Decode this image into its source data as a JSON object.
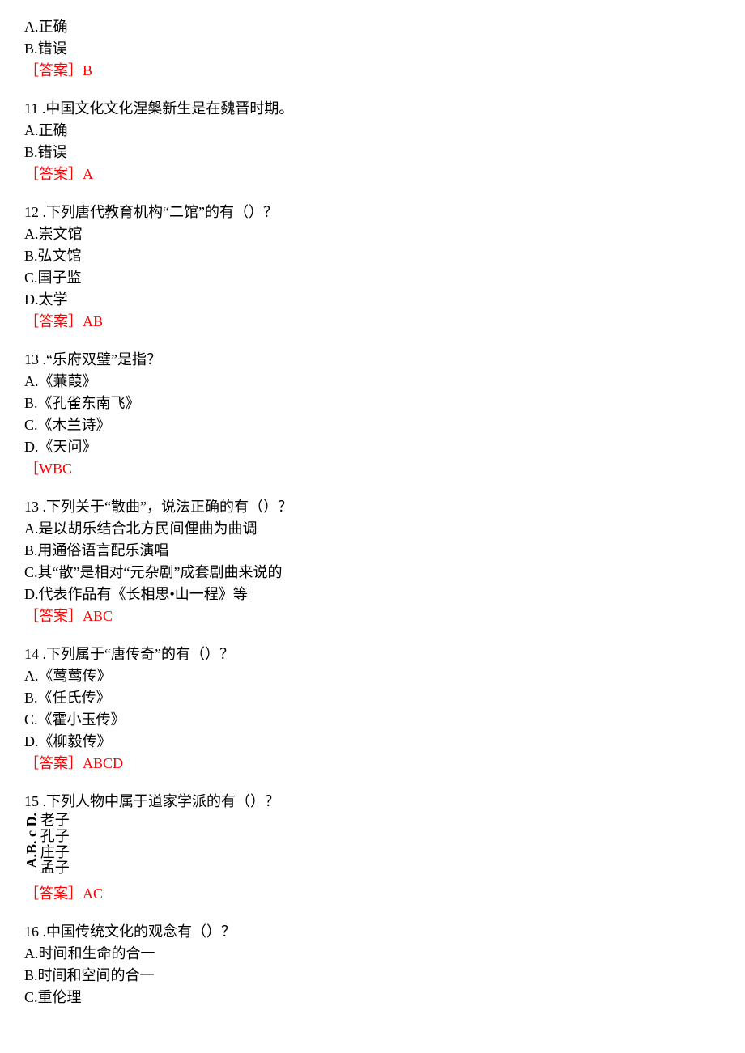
{
  "q10": {
    "optA": "A.正确",
    "optB": "B.错误",
    "answer": "［答案］B"
  },
  "q11": {
    "stem": "11 .中国文化文化涅槃新生是在魏晋时期。",
    "optA": "A.正确",
    "optB": "B.错误",
    "answer": "［答案］A"
  },
  "q12": {
    "stem": "12 .下列唐代教育机构“二馆”的有（）？",
    "optA": "A.崇文馆",
    "optB": "B.弘文馆",
    "optC": "C.国子监",
    "optD": "D.太学",
    "answer": "［答案］AB"
  },
  "q13a": {
    "stem": "13 .“乐府双璧”是指？",
    "optA": "A.《蒹葭》",
    "optB": "B.《孔雀东南飞》",
    "optC": "C.《木兰诗》",
    "optD": "D.《天问》",
    "answer": "［WBC"
  },
  "q13b": {
    "stem": "13 .下列关于“散曲”，说法正确的有（）？",
    "optA": "A.是以胡乐结合北方民间俚曲为曲调",
    "optB": "B.用通俗语言配乐演唱",
    "optC": "C.其“散”是相对“元杂剧”成套剧曲来说的",
    "optD": "D.代表作品有《长相思•山一程》等",
    "answer": "［答案］ABC"
  },
  "q14": {
    "stem": "14 .下列属于“唐传奇”的有（）？",
    "optA": "A.《莺莺传》",
    "optB": "B.《任氏传》",
    "optC": "C.《霍小玉传》",
    "optD": "D.《柳毅传》",
    "answer": "［答案］ABCD"
  },
  "q15": {
    "stem": "15 .下列人物中属于道家学派的有（）？",
    "labelVert": "A.B. c D.",
    "optA": "老子",
    "optB": "孔子",
    "optC": "庄子",
    "optD": "孟子",
    "answer": "［答案］AC"
  },
  "q16": {
    "stem": "16 .中国传统文化的观念有（）？",
    "optA": "A.时间和生命的合一",
    "optB": "B.时间和空间的合一",
    "optC": "C.重伦理"
  }
}
